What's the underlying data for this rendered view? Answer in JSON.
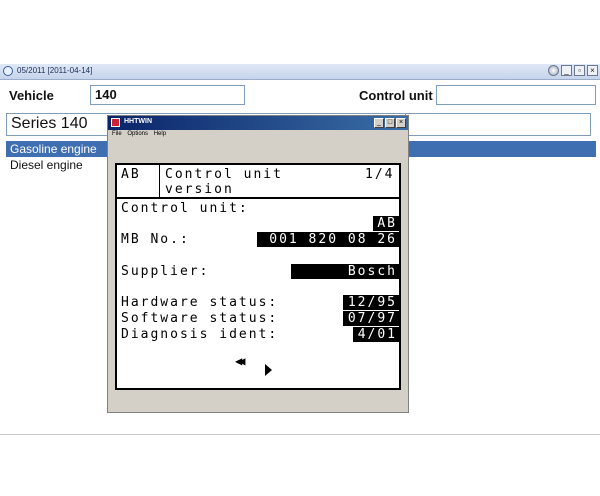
{
  "titlebar": {
    "title": "05/2011 [2011-04-14]"
  },
  "toolbar": {
    "vehicle_label": "Vehicle",
    "vehicle_value": "140",
    "control_unit_label": "Control unit",
    "control_unit_value": ""
  },
  "series": {
    "label": "Series 140"
  },
  "engine_list": {
    "items": [
      {
        "label": "Gasoline engine",
        "selected": true
      },
      {
        "label": "Diesel engine",
        "selected": false
      }
    ]
  },
  "child": {
    "title": "HHTWIN",
    "menu": [
      "File",
      "Options",
      "Help"
    ],
    "screen": {
      "code": "AB",
      "heading_line1": "Control unit",
      "heading_line2": "version",
      "page": "1/4",
      "control_unit_label": "Control unit:",
      "control_unit_value": "AB",
      "mb_label": "MB No.:",
      "mb_value": "001 820 08 26",
      "supplier_label": "Supplier:",
      "supplier_value": "Bosch",
      "hardware_label": "Hardware status:",
      "hardware_value": "12/95",
      "software_label": "Software status:",
      "software_value": "07/97",
      "diag_label": "Diagnosis ident:",
      "diag_value": "4/01"
    }
  },
  "icons": {
    "app": "circle-app-icon",
    "help": "help-round-icon",
    "back": "double-left-arrow-icon",
    "forward": "right-arrow-icon"
  },
  "colors": {
    "selection": "#3f6fb0",
    "child_title": "#0a246a"
  }
}
